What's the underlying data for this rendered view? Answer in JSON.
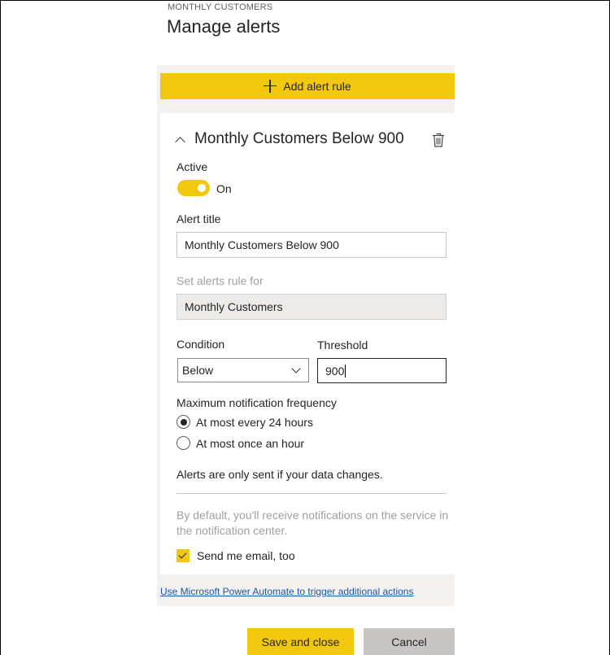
{
  "header": {
    "eyebrow": "MONTHLY CUSTOMERS",
    "title": "Manage alerts"
  },
  "add_rule": {
    "label": "Add alert rule",
    "icon": "plus-icon"
  },
  "rule": {
    "title": "Monthly Customers Below 900",
    "collapse_icon": "chevron-up-icon",
    "delete_icon": "trash-icon",
    "active": {
      "label": "Active",
      "state": "On",
      "value": true
    },
    "alert_title": {
      "label": "Alert title",
      "value": "Monthly Customers Below 900"
    },
    "rule_for": {
      "label": "Set alerts rule for",
      "value": "Monthly Customers"
    },
    "condition": {
      "label": "Condition",
      "value": "Below"
    },
    "threshold": {
      "label": "Threshold",
      "value": "900"
    },
    "frequency": {
      "label": "Maximum notification frequency",
      "options": [
        {
          "label": "At most every 24 hours",
          "selected": true
        },
        {
          "label": "At most once an hour",
          "selected": false
        }
      ]
    },
    "data_note": "Alerts are only sent if your data changes.",
    "default_note": "By default, you'll receive notifications on the service in the notification center.",
    "email": {
      "label": "Send me email, too",
      "checked": true
    }
  },
  "automate_link": "Use Microsoft Power Automate to trigger additional actions",
  "footer": {
    "save_label": "Save and close",
    "cancel_label": "Cancel"
  },
  "colors": {
    "accent": "#f2c80f",
    "panel_bg": "#f3f2f1",
    "link": "#1a54a6",
    "muted_text": "#a19f9d"
  }
}
